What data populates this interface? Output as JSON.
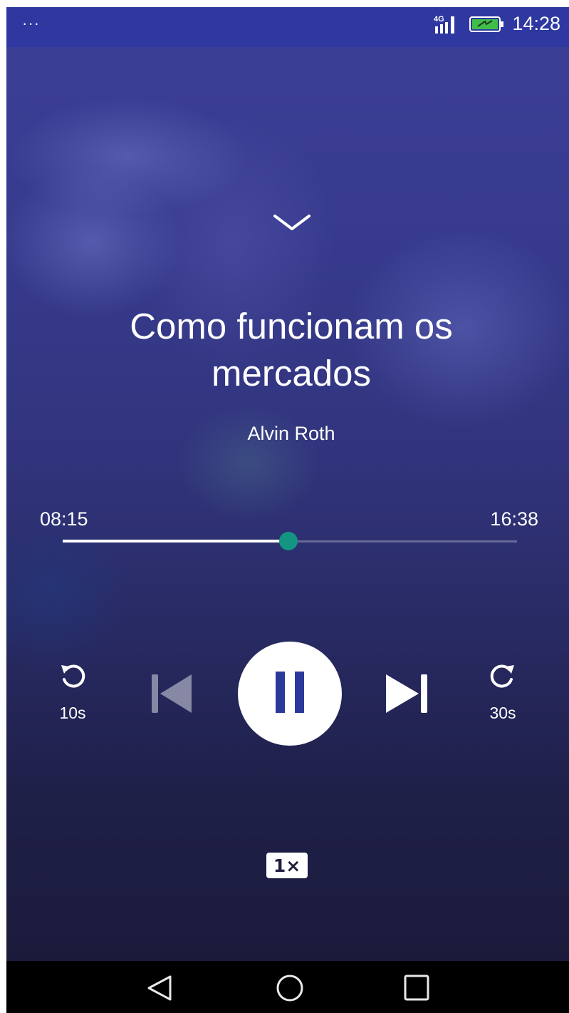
{
  "status_bar": {
    "dots": "···",
    "network": "4G",
    "time": "14:28",
    "icons": [
      "signal-icon",
      "battery-charging-icon"
    ]
  },
  "player": {
    "collapse_icon": "chevron-down-icon",
    "title": "Como funcionam os mercados",
    "author": "Alvin Roth",
    "time_elapsed": "08:15",
    "time_total": "16:38",
    "progress": 0.497,
    "accent_color": "#149582",
    "rewind_label": "10s",
    "forward_label": "30s",
    "speed": "1×",
    "controls": [
      "rewind-10-icon",
      "skip-previous-icon",
      "pause-icon",
      "skip-next-icon",
      "forward-30-icon"
    ]
  },
  "nav_bar": {
    "icons": [
      "back-triangle-icon",
      "home-circle-icon",
      "recents-square-icon"
    ]
  }
}
